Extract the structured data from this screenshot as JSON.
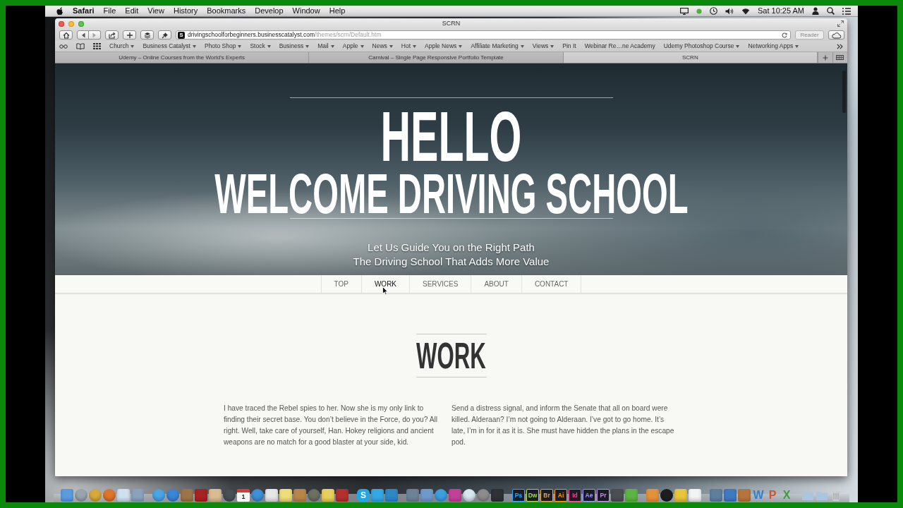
{
  "menu_bar": {
    "app": "Safari",
    "items": [
      "File",
      "Edit",
      "View",
      "History",
      "Bookmarks",
      "Develop",
      "Window",
      "Help"
    ],
    "clock": "Sat 10:25 AM"
  },
  "browser": {
    "title": "SCRN",
    "url": {
      "favicon": "S",
      "host": "drivingschoolforbeginners.businesscatalyst.com",
      "path": "/themes/scrn/Default.htm"
    },
    "reader": {
      "label": "Reader",
      "disabled": true
    },
    "bookmarks": [
      {
        "label": "Church",
        "menu": true
      },
      {
        "label": "Business Catalyst",
        "menu": true
      },
      {
        "label": "Photo Shop",
        "menu": true
      },
      {
        "label": "Stock",
        "menu": true
      },
      {
        "label": "Business",
        "menu": true
      },
      {
        "label": "Mail",
        "menu": true
      },
      {
        "label": "Apple",
        "menu": true
      },
      {
        "label": "News",
        "menu": true
      },
      {
        "label": "Hot",
        "menu": true
      },
      {
        "label": "Apple News",
        "menu": true
      },
      {
        "label": "Affiliate Marketing",
        "menu": true
      },
      {
        "label": "Views",
        "menu": true
      },
      {
        "label": "Pin It",
        "menu": false
      },
      {
        "label": "Webinar Re…ne Academy",
        "menu": false
      },
      {
        "label": "Udemy Photoshop Course",
        "menu": true
      },
      {
        "label": "Networking Apps",
        "menu": true
      }
    ],
    "tabs": [
      {
        "title": "Udemy – Online Courses from the World's Experts",
        "selected": false
      },
      {
        "title": "Carnival – Single Page Responsive Portfolio Template",
        "selected": false
      },
      {
        "title": "SCRN",
        "selected": true
      }
    ]
  },
  "page": {
    "hero": {
      "title": "HELLO",
      "subtitle": "WELCOME DRIVING SCHOOL",
      "taglines": [
        "Let Us Guide You on the Right Path",
        "The Driving School That Adds More Value"
      ]
    },
    "nav": [
      {
        "label": "TOP",
        "selected": false
      },
      {
        "label": "WORK",
        "selected": true
      },
      {
        "label": "SERVICES",
        "selected": false
      },
      {
        "label": "ABOUT",
        "selected": false
      },
      {
        "label": "CONTACT",
        "selected": false
      }
    ],
    "section": {
      "heading": "WORK",
      "paragraphs": [
        "I have traced the Rebel spies to her. Now she is my only link to finding their secret base. You don’t believe in the Force, do you? All right. Well, take care of yourself, Han. Hokey religions and ancient weapons are no match for a good blaster at your side, kid.",
        "Send a distress signal, and inform the Senate that all on board were killed. Alderaan? I’m not going to Alderaan. I’ve got to go home. It’s late, I’m in for it as it is. She must have hidden the plans in the escape pod."
      ]
    }
  },
  "dock": {
    "groups": [
      [
        {
          "kind": "tile",
          "color": "#5b9be0"
        },
        {
          "kind": "round",
          "color": "#9aa4ae"
        },
        {
          "kind": "round",
          "color": "#d8a93a"
        },
        {
          "kind": "round",
          "color": "#e0742a"
        },
        {
          "kind": "tile",
          "color": "#cfe0ee"
        },
        {
          "kind": "tile",
          "color": "#8aa2bc"
        }
      ],
      [
        {
          "kind": "round",
          "color": "#49a6e6"
        },
        {
          "kind": "round",
          "color": "#3a86d8"
        },
        {
          "kind": "tile",
          "color": "#9c7448"
        },
        {
          "kind": "tile",
          "color": "#a82222"
        },
        {
          "kind": "tile",
          "color": "#d9bc90"
        },
        {
          "kind": "round",
          "color": "#4a4f57"
        },
        {
          "kind": "calendar",
          "color": "#d83a34",
          "label": "1"
        },
        {
          "kind": "round",
          "color": "#3f8fd8"
        },
        {
          "kind": "tile",
          "color": "#e6e6e6"
        },
        {
          "kind": "tile",
          "color": "#eedd78"
        },
        {
          "kind": "tile",
          "color": "#b8864a"
        },
        {
          "kind": "round",
          "color": "#6c7060"
        },
        {
          "kind": "tile",
          "color": "#e8cf5a"
        },
        {
          "kind": "tile",
          "color": "#b3302c"
        }
      ],
      [
        {
          "kind": "badge",
          "color": "#22a6e4",
          "label": "S"
        },
        {
          "kind": "tile",
          "color": "#33a8e6"
        },
        {
          "kind": "tile",
          "color": "#2d88c6"
        }
      ],
      [
        {
          "kind": "tile",
          "color": "#6d8299"
        },
        {
          "kind": "tile",
          "color": "#6f99c9"
        },
        {
          "kind": "round",
          "color": "#3c9fe0"
        },
        {
          "kind": "tile",
          "color": "#c24196"
        },
        {
          "kind": "round",
          "color": "#d9e8f0"
        },
        {
          "kind": "round",
          "color": "#8c8c8c"
        },
        {
          "kind": "tile",
          "color": "#2e3236"
        }
      ],
      [
        {
          "kind": "letter",
          "color": "#31a8ff",
          "label": "Ps"
        },
        {
          "kind": "letter",
          "color": "#9fdd4e",
          "label": "Dw"
        },
        {
          "kind": "letter",
          "color": "#e8a23e",
          "label": "Br"
        },
        {
          "kind": "letter",
          "color": "#ff9a00",
          "label": "Ai"
        },
        {
          "kind": "letter",
          "color": "#ff3f94",
          "label": "Id"
        },
        {
          "kind": "letter",
          "color": "#9999ff",
          "label": "Ae"
        },
        {
          "kind": "letter",
          "color": "#c58cf0",
          "label": "Pr"
        },
        {
          "kind": "tile",
          "color": "#4b4f54"
        },
        {
          "kind": "tile",
          "color": "#5db443"
        }
      ],
      [
        {
          "kind": "tile",
          "color": "#e4913a"
        },
        {
          "kind": "round",
          "color": "#1e1e1e"
        },
        {
          "kind": "tile",
          "color": "#e9c53a"
        },
        {
          "kind": "tile",
          "color": "#f3f3f3"
        }
      ],
      [
        {
          "kind": "tile",
          "color": "#5f7f9f"
        },
        {
          "kind": "tile",
          "color": "#3f79c0"
        },
        {
          "kind": "tile",
          "color": "#b5763e"
        },
        {
          "kind": "glyph",
          "color": "#2f7fd0",
          "label": "W"
        },
        {
          "kind": "glyph",
          "color": "#d4532a",
          "label": "P"
        },
        {
          "kind": "glyph",
          "color": "#3e9e3e",
          "label": "X"
        }
      ],
      [
        {
          "kind": "folder",
          "color": "#a9c6de"
        },
        {
          "kind": "folder",
          "color": "#a9c6de"
        },
        {
          "kind": "trash",
          "color": "#c9cccf"
        }
      ]
    ]
  }
}
